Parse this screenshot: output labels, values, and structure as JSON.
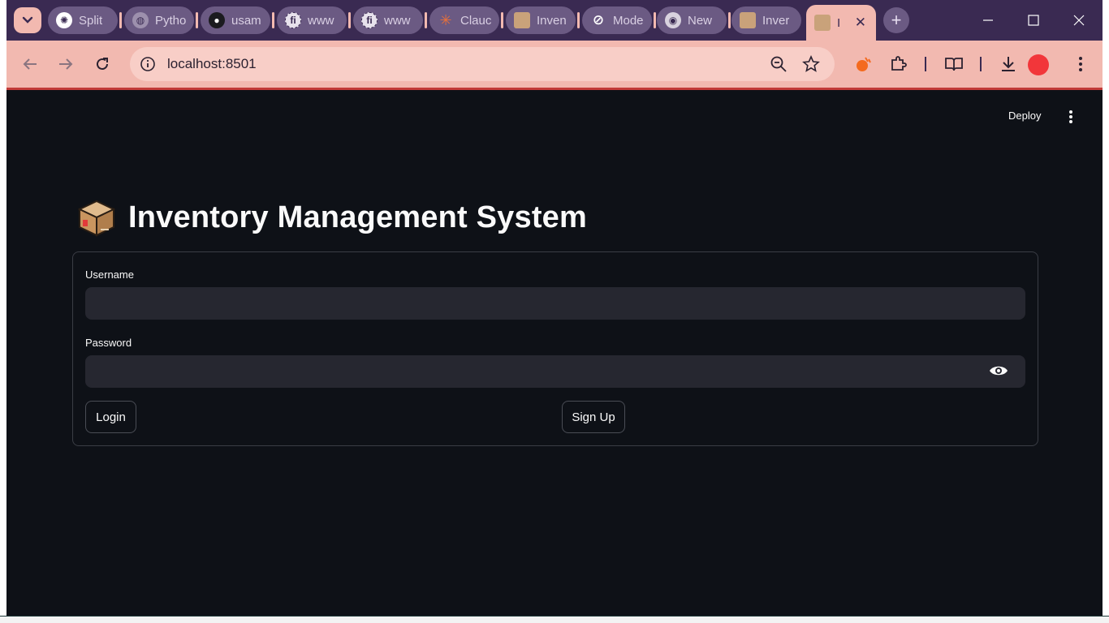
{
  "browser": {
    "tabs": [
      {
        "label": "Split",
        "icon": "openai-icon"
      },
      {
        "label": "Pytho",
        "icon": "globe-icon"
      },
      {
        "label": "usam",
        "icon": "github-icon"
      },
      {
        "label": "www",
        "icon": "fi-icon"
      },
      {
        "label": "www",
        "icon": "fi-icon"
      },
      {
        "label": "Clauc",
        "icon": "claude-icon"
      },
      {
        "label": "Inven",
        "icon": "box-icon"
      },
      {
        "label": "Mode",
        "icon": "model-icon"
      },
      {
        "label": "New",
        "icon": "chrome-icon"
      },
      {
        "label": "Inver",
        "icon": "box-icon"
      },
      {
        "label": "I",
        "icon": "box-icon",
        "active": true
      }
    ],
    "url": "localhost:8501",
    "colors": {
      "tabstrip": "#3a2a52",
      "toolbar": "#f2b9b0",
      "profile": "#f2363a"
    }
  },
  "app": {
    "deploy_label": "Deploy",
    "title": "Inventory Management System",
    "title_icon": "package-icon",
    "form": {
      "username_label": "Username",
      "username_value": "",
      "password_label": "Password",
      "password_value": "",
      "login_label": "Login",
      "signup_label": "Sign Up"
    }
  }
}
